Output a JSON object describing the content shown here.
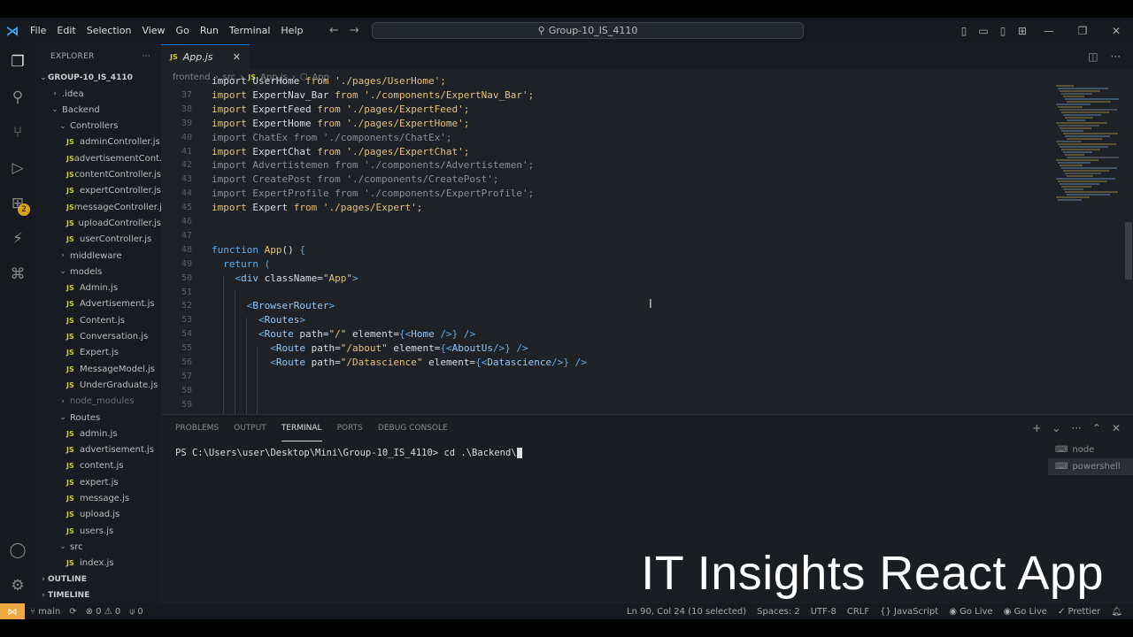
{
  "window": {
    "search_text": "Group-10_IS_4110"
  },
  "menu": [
    "File",
    "Edit",
    "Selection",
    "View",
    "Go",
    "Run",
    "Terminal",
    "Help"
  ],
  "activity_bar": {
    "extensions_badge": "2"
  },
  "explorer": {
    "title": "EXPLORER",
    "root": "GROUP-10_IS_4110",
    "tree": [
      {
        "label": ".idea",
        "kind": "folder",
        "depth": 1,
        "open": false
      },
      {
        "label": "Backend",
        "kind": "folder",
        "depth": 1,
        "open": true
      },
      {
        "label": "Controllers",
        "kind": "folder",
        "depth": 2,
        "open": true
      },
      {
        "label": "adminController.js",
        "kind": "js",
        "depth": 3
      },
      {
        "label": "advertisementCont...",
        "kind": "js",
        "depth": 3
      },
      {
        "label": "contentController.js",
        "kind": "js",
        "depth": 3
      },
      {
        "label": "expertController.js",
        "kind": "js",
        "depth": 3
      },
      {
        "label": "messageController.js",
        "kind": "js",
        "depth": 3
      },
      {
        "label": "uploadController.js",
        "kind": "js",
        "depth": 3
      },
      {
        "label": "userController.js",
        "kind": "js",
        "depth": 3
      },
      {
        "label": "middleware",
        "kind": "folder",
        "depth": 2,
        "open": false
      },
      {
        "label": "models",
        "kind": "folder",
        "depth": 2,
        "open": true
      },
      {
        "label": "Admin.js",
        "kind": "js",
        "depth": 3
      },
      {
        "label": "Advertisement.js",
        "kind": "js",
        "depth": 3
      },
      {
        "label": "Content.js",
        "kind": "js",
        "depth": 3
      },
      {
        "label": "Conversation.js",
        "kind": "js",
        "depth": 3
      },
      {
        "label": "Expert.js",
        "kind": "js",
        "depth": 3
      },
      {
        "label": "MessageModel.js",
        "kind": "js",
        "depth": 3
      },
      {
        "label": "UnderGraduate.js",
        "kind": "js",
        "depth": 3
      },
      {
        "label": "node_modules",
        "kind": "folder",
        "depth": 2,
        "open": false,
        "dim": true
      },
      {
        "label": "Routes",
        "kind": "folder",
        "depth": 2,
        "open": true
      },
      {
        "label": "admin.js",
        "kind": "js",
        "depth": 3
      },
      {
        "label": "advertisement.js",
        "kind": "js",
        "depth": 3
      },
      {
        "label": "content.js",
        "kind": "js",
        "depth": 3
      },
      {
        "label": "expert.js",
        "kind": "js",
        "depth": 3
      },
      {
        "label": "message.js",
        "kind": "js",
        "depth": 3
      },
      {
        "label": "upload.js",
        "kind": "js",
        "depth": 3
      },
      {
        "label": "users.js",
        "kind": "js",
        "depth": 3
      },
      {
        "label": "src",
        "kind": "folder",
        "depth": 2,
        "open": true
      },
      {
        "label": "index.js",
        "kind": "js",
        "depth": 3
      }
    ],
    "outline": "OUTLINE",
    "timeline": "TIMELINE"
  },
  "editor": {
    "tab_label": "App.js",
    "breadcrumb": [
      "frontend",
      "src",
      "App.js",
      "App"
    ],
    "lines": [
      {
        "n": "",
        "segs": [
          [
            "ident",
            "import UserHome "
          ],
          [
            "kw",
            "from "
          ],
          [
            "str",
            "'./pages/UserHome';"
          ]
        ]
      },
      {
        "n": "37",
        "segs": [
          [
            "kw",
            "import "
          ],
          [
            "ident",
            "ExpertNav_Bar "
          ],
          [
            "kw",
            "from "
          ],
          [
            "str",
            "'./components/ExpertNav_Bar';"
          ]
        ]
      },
      {
        "n": "38",
        "segs": [
          [
            "kw",
            "import "
          ],
          [
            "ident",
            "ExpertFeed "
          ],
          [
            "kw",
            "from "
          ],
          [
            "str",
            "'./pages/ExpertFeed';"
          ]
        ]
      },
      {
        "n": "39",
        "segs": [
          [
            "kw",
            "import "
          ],
          [
            "ident",
            "ExpertHome "
          ],
          [
            "kw",
            "from "
          ],
          [
            "str",
            "'./pages/ExpertHome';"
          ]
        ]
      },
      {
        "n": "40",
        "segs": [
          [
            "muted",
            "import ChatEx from './components/ChatEx';"
          ]
        ]
      },
      {
        "n": "41",
        "segs": [
          [
            "kw",
            "import "
          ],
          [
            "ident",
            "ExpertChat "
          ],
          [
            "kw",
            "from "
          ],
          [
            "str",
            "'./pages/ExpertChat';"
          ]
        ]
      },
      {
        "n": "42",
        "segs": [
          [
            "muted",
            "import Advertistemen from './components/Advertistemen';"
          ]
        ]
      },
      {
        "n": "43",
        "segs": [
          [
            "muted",
            "import CreatePost from './components/CreatePost';"
          ]
        ]
      },
      {
        "n": "44",
        "segs": [
          [
            "muted",
            "import ExpertProfile from './components/ExpertProfile';"
          ]
        ]
      },
      {
        "n": "45",
        "segs": [
          [
            "kw",
            "import "
          ],
          [
            "ident",
            "Expert "
          ],
          [
            "kw",
            "from "
          ],
          [
            "str",
            "'./pages/Expert';"
          ]
        ]
      },
      {
        "n": "46",
        "segs": []
      },
      {
        "n": "47",
        "segs": []
      },
      {
        "n": "48",
        "segs": [
          [
            "kw2",
            "function "
          ],
          [
            "fn",
            "App"
          ],
          [
            "ident",
            "() "
          ],
          [
            "br",
            "{"
          ]
        ]
      },
      {
        "n": "49",
        "segs": [
          [
            "ident",
            "  "
          ],
          [
            "kw2",
            "return "
          ],
          [
            "br",
            "("
          ]
        ]
      },
      {
        "n": "50",
        "segs": [
          [
            "ident",
            "    "
          ],
          [
            "tag",
            "<"
          ],
          [
            "tagname",
            "div "
          ],
          [
            "attr",
            "className="
          ],
          [
            "str",
            "\"App\""
          ],
          [
            "tag",
            ">"
          ]
        ]
      },
      {
        "n": "51",
        "segs": []
      },
      {
        "n": "52",
        "segs": [
          [
            "ident",
            "      "
          ],
          [
            "tag",
            "<"
          ],
          [
            "tagname",
            "BrowserRouter"
          ],
          [
            "tag",
            ">"
          ]
        ]
      },
      {
        "n": "53",
        "segs": [
          [
            "ident",
            "        "
          ],
          [
            "tag",
            "<"
          ],
          [
            "tagname",
            "Routes"
          ],
          [
            "tag",
            ">"
          ]
        ]
      },
      {
        "n": "54",
        "segs": [
          [
            "ident",
            "        "
          ],
          [
            "tag",
            "<"
          ],
          [
            "tagname",
            "Route "
          ],
          [
            "attr",
            "path="
          ],
          [
            "str",
            "\"/\" "
          ],
          [
            "attr",
            "element="
          ],
          [
            "br",
            "{"
          ],
          [
            "tag",
            "<"
          ],
          [
            "tagname",
            "Home "
          ],
          [
            "tag",
            "/>"
          ],
          [
            "br",
            "}"
          ],
          [
            "tag",
            " />"
          ]
        ]
      },
      {
        "n": "55",
        "segs": [
          [
            "ident",
            "          "
          ],
          [
            "tag",
            "<"
          ],
          [
            "tagname",
            "Route "
          ],
          [
            "attr",
            "path="
          ],
          [
            "str",
            "\"/about\" "
          ],
          [
            "attr",
            "element="
          ],
          [
            "br",
            "{"
          ],
          [
            "tag",
            "<"
          ],
          [
            "tagname",
            "AboutUs"
          ],
          [
            "tag",
            "/>"
          ],
          [
            "br",
            "}"
          ],
          [
            "tag",
            " />"
          ]
        ]
      },
      {
        "n": "56",
        "segs": [
          [
            "ident",
            "          "
          ],
          [
            "tag",
            "<"
          ],
          [
            "tagname",
            "Route "
          ],
          [
            "attr",
            "path="
          ],
          [
            "str",
            "\"/Datascience\" "
          ],
          [
            "attr",
            "element="
          ],
          [
            "br",
            "{"
          ],
          [
            "tag",
            "<"
          ],
          [
            "tagname",
            "Datascience"
          ],
          [
            "tag",
            "/>"
          ],
          [
            "br",
            "}"
          ],
          [
            "tag",
            " />"
          ]
        ]
      },
      {
        "n": "57",
        "segs": []
      },
      {
        "n": "58",
        "segs": []
      },
      {
        "n": "59",
        "segs": []
      }
    ]
  },
  "panel": {
    "tabs": [
      "PROBLEMS",
      "OUTPUT",
      "TERMINAL",
      "PORTS",
      "DEBUG CONSOLE"
    ],
    "active_tab": "TERMINAL",
    "prompt": "PS C:\\Users\\user\\Desktop\\Mini\\Group-10_IS_4110> ",
    "command": "cd .\\Backend\\",
    "terminals": [
      "node",
      "powershell"
    ],
    "overlay_text": "IT Insights React App"
  },
  "status": {
    "branch": "main",
    "errors": "0",
    "warnings": "0",
    "ports": "0",
    "position": "Ln 90, Col 24 (10 selected)",
    "spaces": "Spaces: 2",
    "encoding": "UTF-8",
    "eol": "CRLF",
    "language": "JavaScript",
    "golive1": "Go Live",
    "golive2": "Go Live",
    "prettier": "Prettier"
  }
}
